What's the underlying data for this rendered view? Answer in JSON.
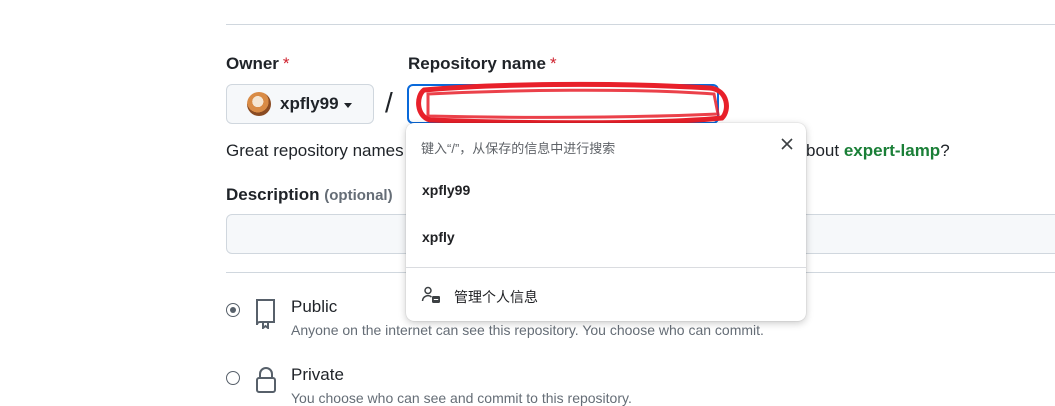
{
  "form": {
    "owner_label": "Owner",
    "owner_value": "xpfly99",
    "repo_label": "Repository name",
    "required_mark": "*",
    "slash": "/",
    "repo_value": "",
    "hint_text": "Great repository names",
    "hint_suffix": "bout",
    "hint_link": "expert-lamp",
    "hint_qmark": "?",
    "description_label": "Description",
    "description_optional": "(optional)",
    "description_value": ""
  },
  "visibility": {
    "public_title": "Public",
    "public_desc": "Anyone on the internet can see this repository. You choose who can commit.",
    "public_checked": true,
    "private_title": "Private",
    "private_desc": "You choose who can see and commit to this repository.",
    "private_checked": false
  },
  "autofill": {
    "hint": "键入“/”，从保存的信息中进行搜索",
    "suggestions": [
      "xpfly99",
      "xpfly"
    ],
    "manage_label": "管理个人信息"
  },
  "colors": {
    "accent": "#0969da",
    "required": "#cf222e",
    "link": "#1a7f37",
    "redaction": "#e8202a"
  }
}
